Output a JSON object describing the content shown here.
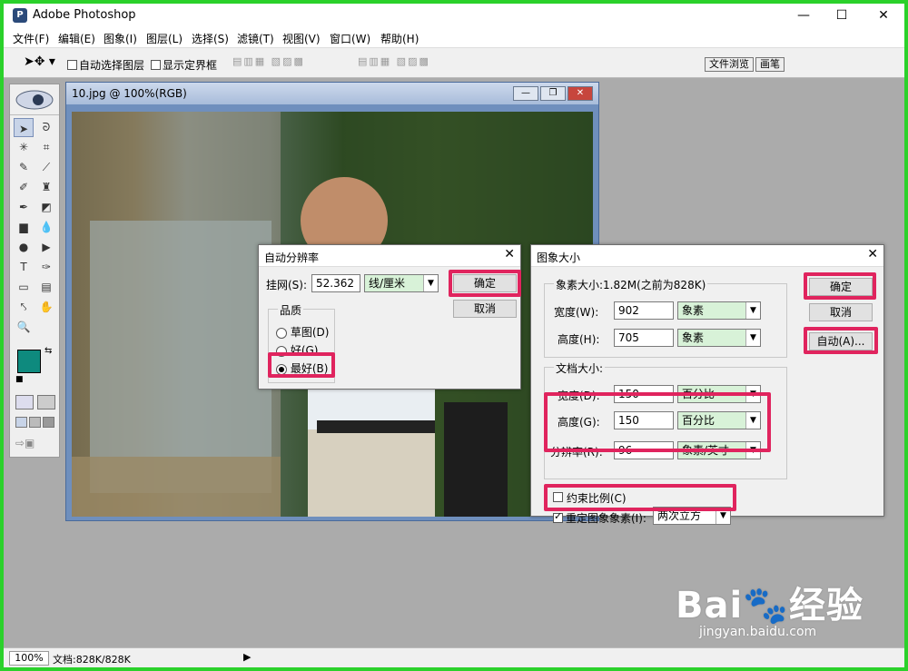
{
  "app": {
    "title": "Adobe Photoshop",
    "minimize": "—",
    "maximize": "☐",
    "close": "✕"
  },
  "menu": [
    "文件(F)",
    "编辑(E)",
    "图象(I)",
    "图层(L)",
    "选择(S)",
    "滤镜(T)",
    "视图(V)",
    "窗口(W)",
    "帮助(H)"
  ],
  "options": {
    "auto_select": "自动选择图层",
    "show_bounds": "显示定界框",
    "palette_tabs": [
      "文件浏览",
      "画笔"
    ]
  },
  "document": {
    "title": "10.jpg @ 100%(RGB)"
  },
  "auto_res": {
    "title": "自动分辨率",
    "screen_label": "挂网(S):",
    "screen_value": "52.362",
    "screen_unit": "线/厘米",
    "ok": "确定",
    "cancel": "取消",
    "quality_label": "品质",
    "options": [
      "草图(D)",
      "好(G)",
      "最好(B)"
    ],
    "selected": 2
  },
  "image_size": {
    "title": "图象大小",
    "pixel_group": "象素大小:1.82M(之前为828K)",
    "width_label": "宽度(W):",
    "width_value": "902",
    "width_unit": "象素",
    "height_label": "高度(H):",
    "height_value": "705",
    "height_unit": "象素",
    "doc_group": "文档大小:",
    "dwidth_label": "宽度(D):",
    "dwidth_value": "150",
    "dwidth_unit": "百分比",
    "dheight_label": "高度(G):",
    "dheight_value": "150",
    "dheight_unit": "百分比",
    "res_label": "分辨率(R):",
    "res_value": "96",
    "res_unit": "象素/英寸",
    "constrain": "约束比例(C)",
    "resample": "重定图象象素(I):",
    "resample_method": "两次立方",
    "ok": "确定",
    "cancel": "取消",
    "auto": "自动(A)..."
  },
  "status": {
    "zoom": "100%",
    "doc_info": "文档:828K/828K"
  },
  "watermark": {
    "brand": "Bai",
    "brand2": "经验",
    "url": "jingyan.baidu.com"
  },
  "colors": {
    "highlight": "#e0245e",
    "frame": "#2bd12b",
    "foreground": "#0e8a7e"
  }
}
